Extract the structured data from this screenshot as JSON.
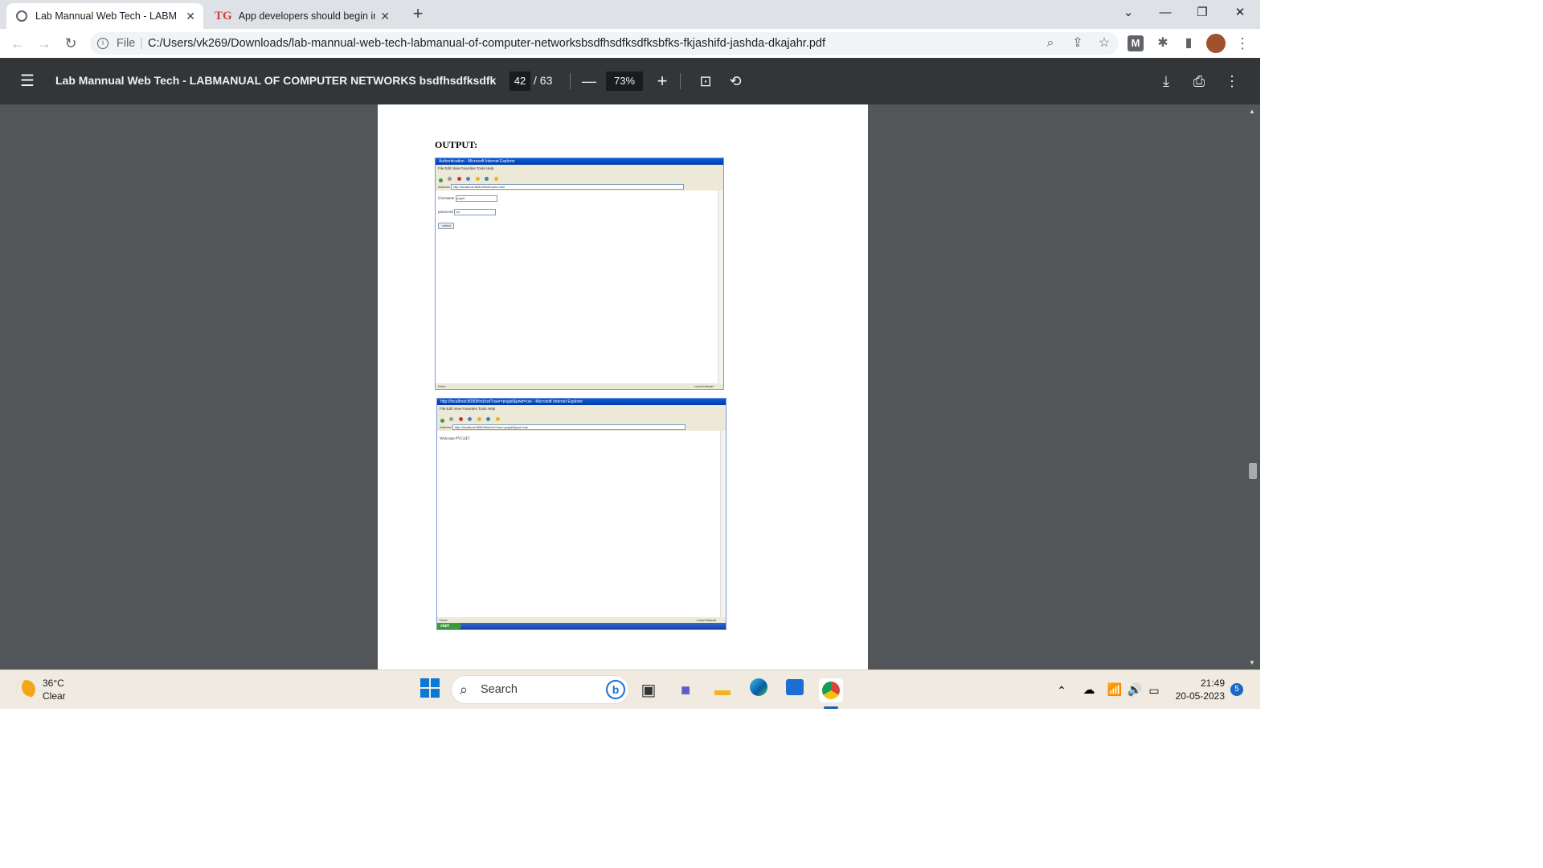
{
  "browser": {
    "tabs": [
      {
        "title": "Lab Mannual Web Tech - LABMA",
        "active": true
      },
      {
        "title": "App developers should begin im",
        "active": false
      }
    ],
    "new_tab": "+",
    "address": {
      "scheme_label": "File",
      "url": "C:/Users/vk269/Downloads/lab-mannual-web-tech-labmanual-of-computer-networksbsdfhsdfksdfksbfks-fkjashifd-jashda-dkajahr.pdf"
    },
    "extension_letter": "M"
  },
  "pdf_toolbar": {
    "title": "Lab Mannual Web Tech - LABMANUAL OF COMPUTER NETWORKS bsdfhsdfksdfksb...",
    "page_current": "42",
    "page_total": "/ 63",
    "zoom": "73%"
  },
  "page": {
    "heading": "OUTPUT:",
    "screenshot1": {
      "window_title": "Authentication - Microsoft Internet Explorer",
      "menu": "File   Edit   View   Favorites   Tools   Help",
      "address": "http://localhost:8080/html/home.html",
      "username_label": "Username",
      "username_value": "pvgsit",
      "password_label": "password",
      "password_value": "cse",
      "submit_label": "submit",
      "status_left": "Done",
      "status_right": "Local intranet"
    },
    "screenshot2": {
      "window_title": "http://localhost:8080/first/cet?user=pvgsit&pwd=cse - Microsoft Internet Explorer",
      "menu": "File   Edit   View   Favorites   Tools   Help",
      "address": "http://localhost:8080/first/cet?user=pvgsit&pwd=cse",
      "body_text": "Welcome PVGSIT",
      "status_left": "Done",
      "status_right": "Local intranet",
      "start_label": "start"
    }
  },
  "taskbar": {
    "weather_temp": "36°C",
    "weather_cond": "Clear",
    "search_placeholder": "Search",
    "time": "21:49",
    "date": "20-05-2023",
    "notification_count": "5"
  },
  "colors": {
    "pdf_toolbar": "#323639",
    "viewer_bg": "#525659",
    "tab_strip": "#dee1e6",
    "taskbar": "#f0eae1"
  }
}
